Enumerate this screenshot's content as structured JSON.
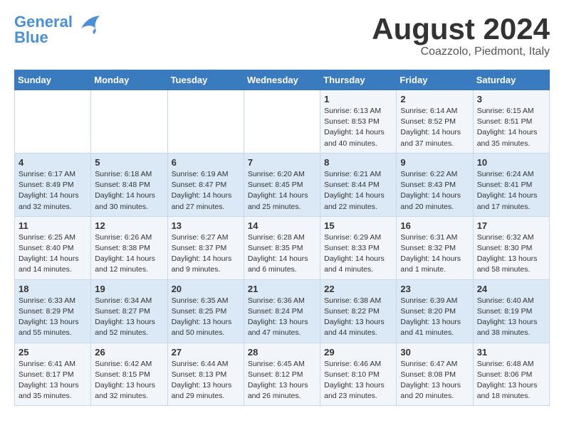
{
  "logo": {
    "general": "General",
    "blue": "Blue"
  },
  "title": "August 2024",
  "location": "Coazzolo, Piedmont, Italy",
  "weekdays": [
    "Sunday",
    "Monday",
    "Tuesday",
    "Wednesday",
    "Thursday",
    "Friday",
    "Saturday"
  ],
  "weeks": [
    [
      {
        "day": "",
        "info": ""
      },
      {
        "day": "",
        "info": ""
      },
      {
        "day": "",
        "info": ""
      },
      {
        "day": "",
        "info": ""
      },
      {
        "day": "1",
        "info": "Sunrise: 6:13 AM\nSunset: 8:53 PM\nDaylight: 14 hours and 40 minutes."
      },
      {
        "day": "2",
        "info": "Sunrise: 6:14 AM\nSunset: 8:52 PM\nDaylight: 14 hours and 37 minutes."
      },
      {
        "day": "3",
        "info": "Sunrise: 6:15 AM\nSunset: 8:51 PM\nDaylight: 14 hours and 35 minutes."
      }
    ],
    [
      {
        "day": "4",
        "info": "Sunrise: 6:17 AM\nSunset: 8:49 PM\nDaylight: 14 hours and 32 minutes."
      },
      {
        "day": "5",
        "info": "Sunrise: 6:18 AM\nSunset: 8:48 PM\nDaylight: 14 hours and 30 minutes."
      },
      {
        "day": "6",
        "info": "Sunrise: 6:19 AM\nSunset: 8:47 PM\nDaylight: 14 hours and 27 minutes."
      },
      {
        "day": "7",
        "info": "Sunrise: 6:20 AM\nSunset: 8:45 PM\nDaylight: 14 hours and 25 minutes."
      },
      {
        "day": "8",
        "info": "Sunrise: 6:21 AM\nSunset: 8:44 PM\nDaylight: 14 hours and 22 minutes."
      },
      {
        "day": "9",
        "info": "Sunrise: 6:22 AM\nSunset: 8:43 PM\nDaylight: 14 hours and 20 minutes."
      },
      {
        "day": "10",
        "info": "Sunrise: 6:24 AM\nSunset: 8:41 PM\nDaylight: 14 hours and 17 minutes."
      }
    ],
    [
      {
        "day": "11",
        "info": "Sunrise: 6:25 AM\nSunset: 8:40 PM\nDaylight: 14 hours and 14 minutes."
      },
      {
        "day": "12",
        "info": "Sunrise: 6:26 AM\nSunset: 8:38 PM\nDaylight: 14 hours and 12 minutes."
      },
      {
        "day": "13",
        "info": "Sunrise: 6:27 AM\nSunset: 8:37 PM\nDaylight: 14 hours and 9 minutes."
      },
      {
        "day": "14",
        "info": "Sunrise: 6:28 AM\nSunset: 8:35 PM\nDaylight: 14 hours and 6 minutes."
      },
      {
        "day": "15",
        "info": "Sunrise: 6:29 AM\nSunset: 8:33 PM\nDaylight: 14 hours and 4 minutes."
      },
      {
        "day": "16",
        "info": "Sunrise: 6:31 AM\nSunset: 8:32 PM\nDaylight: 14 hours and 1 minute."
      },
      {
        "day": "17",
        "info": "Sunrise: 6:32 AM\nSunset: 8:30 PM\nDaylight: 13 hours and 58 minutes."
      }
    ],
    [
      {
        "day": "18",
        "info": "Sunrise: 6:33 AM\nSunset: 8:29 PM\nDaylight: 13 hours and 55 minutes."
      },
      {
        "day": "19",
        "info": "Sunrise: 6:34 AM\nSunset: 8:27 PM\nDaylight: 13 hours and 52 minutes."
      },
      {
        "day": "20",
        "info": "Sunrise: 6:35 AM\nSunset: 8:25 PM\nDaylight: 13 hours and 50 minutes."
      },
      {
        "day": "21",
        "info": "Sunrise: 6:36 AM\nSunset: 8:24 PM\nDaylight: 13 hours and 47 minutes."
      },
      {
        "day": "22",
        "info": "Sunrise: 6:38 AM\nSunset: 8:22 PM\nDaylight: 13 hours and 44 minutes."
      },
      {
        "day": "23",
        "info": "Sunrise: 6:39 AM\nSunset: 8:20 PM\nDaylight: 13 hours and 41 minutes."
      },
      {
        "day": "24",
        "info": "Sunrise: 6:40 AM\nSunset: 8:19 PM\nDaylight: 13 hours and 38 minutes."
      }
    ],
    [
      {
        "day": "25",
        "info": "Sunrise: 6:41 AM\nSunset: 8:17 PM\nDaylight: 13 hours and 35 minutes."
      },
      {
        "day": "26",
        "info": "Sunrise: 6:42 AM\nSunset: 8:15 PM\nDaylight: 13 hours and 32 minutes."
      },
      {
        "day": "27",
        "info": "Sunrise: 6:44 AM\nSunset: 8:13 PM\nDaylight: 13 hours and 29 minutes."
      },
      {
        "day": "28",
        "info": "Sunrise: 6:45 AM\nSunset: 8:12 PM\nDaylight: 13 hours and 26 minutes."
      },
      {
        "day": "29",
        "info": "Sunrise: 6:46 AM\nSunset: 8:10 PM\nDaylight: 13 hours and 23 minutes."
      },
      {
        "day": "30",
        "info": "Sunrise: 6:47 AM\nSunset: 8:08 PM\nDaylight: 13 hours and 20 minutes."
      },
      {
        "day": "31",
        "info": "Sunrise: 6:48 AM\nSunset: 8:06 PM\nDaylight: 13 hours and 18 minutes."
      }
    ]
  ]
}
